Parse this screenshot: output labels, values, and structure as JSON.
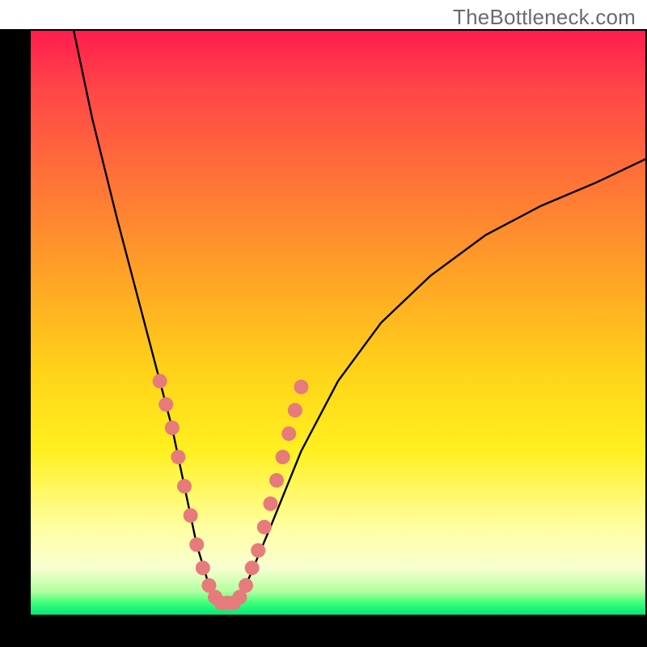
{
  "watermark": "TheBottleneck.com",
  "chart_data": {
    "type": "line",
    "title": "",
    "xlabel": "",
    "ylabel": "",
    "xlim": [
      0,
      100
    ],
    "ylim": [
      0,
      100
    ],
    "grid": false,
    "legend": false,
    "series": [
      {
        "name": "curve",
        "x": [
          7,
          10,
          14,
          18,
          21,
          23,
          25,
          27,
          29,
          31,
          33,
          35,
          39,
          44,
          50,
          57,
          65,
          74,
          83,
          92,
          100
        ],
        "y": [
          100,
          85,
          68,
          52,
          40,
          32,
          22,
          12,
          5,
          2,
          2,
          5,
          15,
          28,
          40,
          50,
          58,
          65,
          70,
          74,
          78
        ]
      }
    ],
    "markers": {
      "name": "highlighted-points",
      "color": "#e77a7a",
      "points": [
        {
          "x": 21,
          "y": 40
        },
        {
          "x": 22,
          "y": 36
        },
        {
          "x": 23,
          "y": 32
        },
        {
          "x": 24,
          "y": 27
        },
        {
          "x": 25,
          "y": 22
        },
        {
          "x": 26,
          "y": 17
        },
        {
          "x": 27,
          "y": 12
        },
        {
          "x": 28,
          "y": 8
        },
        {
          "x": 29,
          "y": 5
        },
        {
          "x": 30,
          "y": 3
        },
        {
          "x": 31,
          "y": 2
        },
        {
          "x": 32,
          "y": 2
        },
        {
          "x": 33,
          "y": 2
        },
        {
          "x": 34,
          "y": 3
        },
        {
          "x": 35,
          "y": 5
        },
        {
          "x": 36,
          "y": 8
        },
        {
          "x": 37,
          "y": 11
        },
        {
          "x": 38,
          "y": 15
        },
        {
          "x": 39,
          "y": 19
        },
        {
          "x": 40,
          "y": 23
        },
        {
          "x": 41,
          "y": 27
        },
        {
          "x": 42,
          "y": 31
        },
        {
          "x": 43,
          "y": 35
        },
        {
          "x": 44,
          "y": 39
        }
      ]
    },
    "background_gradient": {
      "top": "#ff1d4e",
      "mid": "#ffd219",
      "bottom": "#00e87a"
    }
  }
}
